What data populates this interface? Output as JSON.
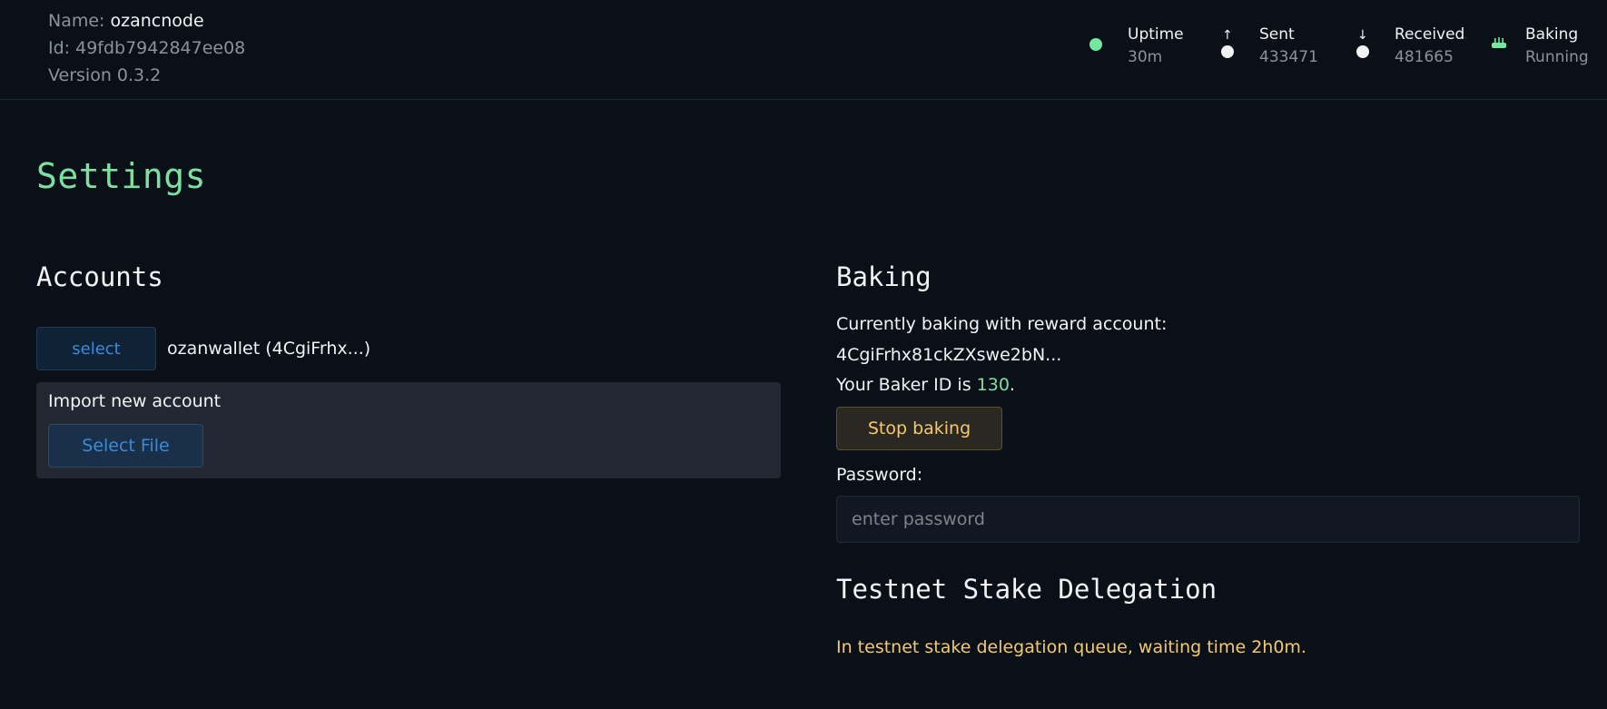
{
  "node": {
    "name_label": "Name:",
    "name_value": "ozancnode",
    "id_text": "Id: 49fdb7942847ee08",
    "version_text": "Version 0.3.2"
  },
  "stats": {
    "uptime": {
      "label": "Uptime",
      "value": "30m",
      "icon": "status-dot-icon",
      "color": "#74e8a0"
    },
    "sent": {
      "label": "Sent",
      "value": "433471",
      "icon": "arrow-up-icon"
    },
    "received": {
      "label": "Received",
      "value": "481665",
      "icon": "arrow-down-icon"
    },
    "baking": {
      "label": "Baking",
      "value": "Running",
      "icon": "cake-icon"
    }
  },
  "page": {
    "title": "Settings"
  },
  "accounts": {
    "title": "Accounts",
    "select_label": "select",
    "account_name": "ozanwallet (4CgiFrhx...)",
    "import_label": "Import new account",
    "select_file_label": "Select File"
  },
  "baking": {
    "title": "Baking",
    "reward_text": "Currently baking with reward account:",
    "reward_account": "4CgiFrhx81ckZXswe2bN...",
    "baker_id_prefix": "Your Baker ID is ",
    "baker_id": "130",
    "baker_id_suffix": ".",
    "stop_label": "Stop baking",
    "password_label": "Password:",
    "password_placeholder": "enter password"
  },
  "testnet": {
    "title": "Testnet Stake Delegation",
    "queue_text": "In testnet stake delegation queue, waiting time 2h0m."
  },
  "colors": {
    "accent_green": "#7ee0a0",
    "accent_blue": "#3a8bd8",
    "warning_yellow": "#f5c96b",
    "background": "#0a1018"
  }
}
